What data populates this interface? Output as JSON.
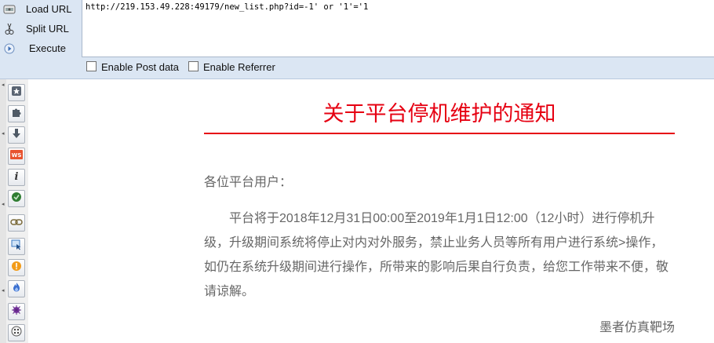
{
  "hackbar": {
    "actions": [
      {
        "label": "Load URL",
        "icon": "load-url-icon"
      },
      {
        "label": "Split URL",
        "icon": "split-url-icon"
      },
      {
        "label": "Execute",
        "icon": "execute-icon"
      }
    ],
    "url_value": "http://219.153.49.228:49179/new_list.php?id=-1' or '1'='1",
    "checkboxes": [
      {
        "label": "Enable Post data",
        "checked": false
      },
      {
        "label": "Enable Referrer",
        "checked": false
      }
    ]
  },
  "toolbar": {
    "icons": [
      "bookmark-star-icon",
      "puzzle-addon-icon",
      "download-arrow-icon",
      "ws-badge-icon",
      "info-icon",
      "shield-icon",
      "chain-link-icon",
      "select-cursor-icon",
      "warning-icon",
      "flame-icon",
      "bug-icon",
      "palette-icon"
    ]
  },
  "notice": {
    "title": "关于平台停机维护的通知",
    "salutation": "各位平台用户：",
    "body": "平台将于2018年12月31日00:00至2019年1月1日12:00（12小时）进行停机升级，升级期间系统将停止对内对外服务，禁止业务人员等所有用户进行系统>操作，如仍在系统升级期间进行操作，所带来的影响后果自行负责，给您工作带来不便，敬请谅解。",
    "signature": "墨者仿真靶场"
  },
  "colors": {
    "title_red": "#e60012",
    "body_gray": "#666666",
    "hackbar_bg": "#dbe6f3"
  }
}
